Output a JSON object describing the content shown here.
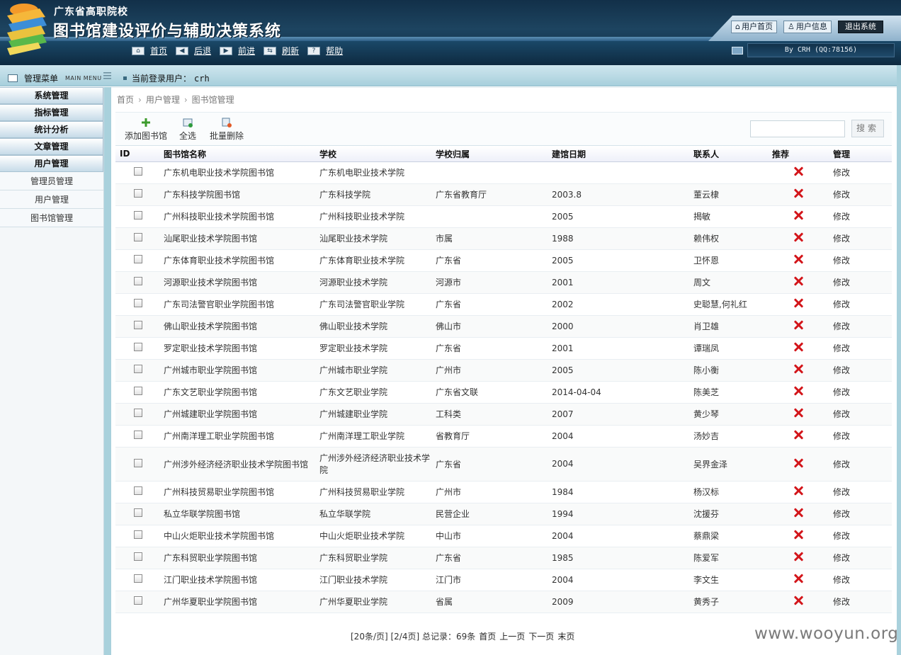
{
  "header": {
    "subtitle": "广东省高职院校",
    "title": "图书馆建设评价与辅助决策系统",
    "top_links": [
      "用户首页",
      "用户信息",
      "退出系统"
    ],
    "nav": [
      "首页",
      "后退",
      "前进",
      "刷新",
      "帮助"
    ],
    "credit": "By CRH (QQ:78156)"
  },
  "subbar": {
    "menu_title": "管理菜单",
    "menu_title_en": "MAIN MENU",
    "login_label": "当前登录用户：",
    "login_user": "crh"
  },
  "sidebar": {
    "groups": [
      "系统管理",
      "指标管理",
      "统计分析",
      "文章管理",
      "用户管理"
    ],
    "items": [
      "管理员管理",
      "用户管理",
      "图书馆管理"
    ]
  },
  "breadcrumb": [
    "首页",
    "用户管理",
    "图书馆管理"
  ],
  "toolbar": {
    "add": "添加图书馆",
    "select_all": "全选",
    "batch_delete": "批量删除",
    "search_placeholder": "",
    "search_button": "搜索"
  },
  "table": {
    "headers": [
      "ID",
      "图书馆名称",
      "学校",
      "学校归属",
      "建馆日期",
      "联系人",
      "推荐",
      "管理"
    ],
    "rows": [
      {
        "name": "广东机电职业技术学院图书馆",
        "school": "广东机电职业技术学院",
        "belong": "",
        "date": "",
        "contact": "",
        "action": "修改"
      },
      {
        "name": "广东科技学院图书馆",
        "school": "广东科技学院",
        "belong": "广东省教育厅",
        "date": "2003.8",
        "contact": "董云棣",
        "action": "修改"
      },
      {
        "name": "广州科技职业技术学院图书馆",
        "school": "广州科技职业技术学院",
        "belong": "",
        "date": "2005",
        "contact": "揭敏",
        "action": "修改"
      },
      {
        "name": "汕尾职业技术学院图书馆",
        "school": "汕尾职业技术学院",
        "belong": "市属",
        "date": "1988",
        "contact": "赖伟权",
        "action": "修改"
      },
      {
        "name": "广东体育职业技术学院图书馆",
        "school": "广东体育职业技术学院",
        "belong": "广东省",
        "date": "2005",
        "contact": "卫怀恩",
        "action": "修改"
      },
      {
        "name": "河源职业技术学院图书馆",
        "school": "河源职业技术学院",
        "belong": "河源市",
        "date": "2001",
        "contact": "周文",
        "action": "修改"
      },
      {
        "name": "广东司法警官职业学院图书馆",
        "school": "广东司法警官职业学院",
        "belong": "广东省",
        "date": "2002",
        "contact": "史聪慧,何礼红",
        "action": "修改"
      },
      {
        "name": "佛山职业技术学院图书馆",
        "school": "佛山职业技术学院",
        "belong": "佛山市",
        "date": "2000",
        "contact": "肖卫雄",
        "action": "修改"
      },
      {
        "name": "罗定职业技术学院图书馆",
        "school": "罗定职业技术学院",
        "belong": "广东省",
        "date": "2001",
        "contact": "谭瑞凤",
        "action": "修改"
      },
      {
        "name": "广州城市职业学院图书馆",
        "school": "广州城市职业学院",
        "belong": "广州市",
        "date": "2005",
        "contact": "陈小衡",
        "action": "修改"
      },
      {
        "name": "广东文艺职业学院图书馆",
        "school": "广东文艺职业学院",
        "belong": "广东省文联",
        "date": "2014-04-04",
        "contact": "陈美芝",
        "action": "修改"
      },
      {
        "name": "广州城建职业学院图书馆",
        "school": "广州城建职业学院",
        "belong": "工科类",
        "date": "2007",
        "contact": "黄少琴",
        "action": "修改"
      },
      {
        "name": "广州南洋理工职业学院图书馆",
        "school": "广州南洋理工职业学院",
        "belong": "省教育厅",
        "date": "2004",
        "contact": "汤妙吉",
        "action": "修改"
      },
      {
        "name": "广州涉外经济经济职业技术学院图书馆",
        "school": "广州涉外经济经济职业技术学院",
        "belong": "广东省",
        "date": "2004",
        "contact": "吴界金泽",
        "action": "修改"
      },
      {
        "name": "广州科技贸易职业学院图书馆",
        "school": "广州科技贸易职业学院",
        "belong": "广州市",
        "date": "1984",
        "contact": "杨汉标",
        "action": "修改"
      },
      {
        "name": "私立华联学院图书馆",
        "school": "私立华联学院",
        "belong": "民营企业",
        "date": "1994",
        "contact": "沈援芬",
        "action": "修改"
      },
      {
        "name": "中山火炬职业技术学院图书馆",
        "school": "中山火炬职业技术学院",
        "belong": "中山市",
        "date": "2004",
        "contact": "蔡鼎梁",
        "action": "修改"
      },
      {
        "name": "广东科贸职业学院图书馆",
        "school": "广东科贸职业学院",
        "belong": "广东省",
        "date": "1985",
        "contact": "陈爱军",
        "action": "修改"
      },
      {
        "name": "江门职业技术学院图书馆",
        "school": "江门职业技术学院",
        "belong": "江门市",
        "date": "2004",
        "contact": "李文生",
        "action": "修改"
      },
      {
        "name": "广州华夏职业学院图书馆",
        "school": "广州华夏职业学院",
        "belong": "省属",
        "date": "2009",
        "contact": "黄秀子",
        "action": "修改"
      }
    ]
  },
  "pager": {
    "summary": "[20条/页] [2/4页] 总记录：69条",
    "first": "首页",
    "prev": "上一页",
    "next": "下一页",
    "last": "末页"
  },
  "watermark": "www.wooyun.org"
}
